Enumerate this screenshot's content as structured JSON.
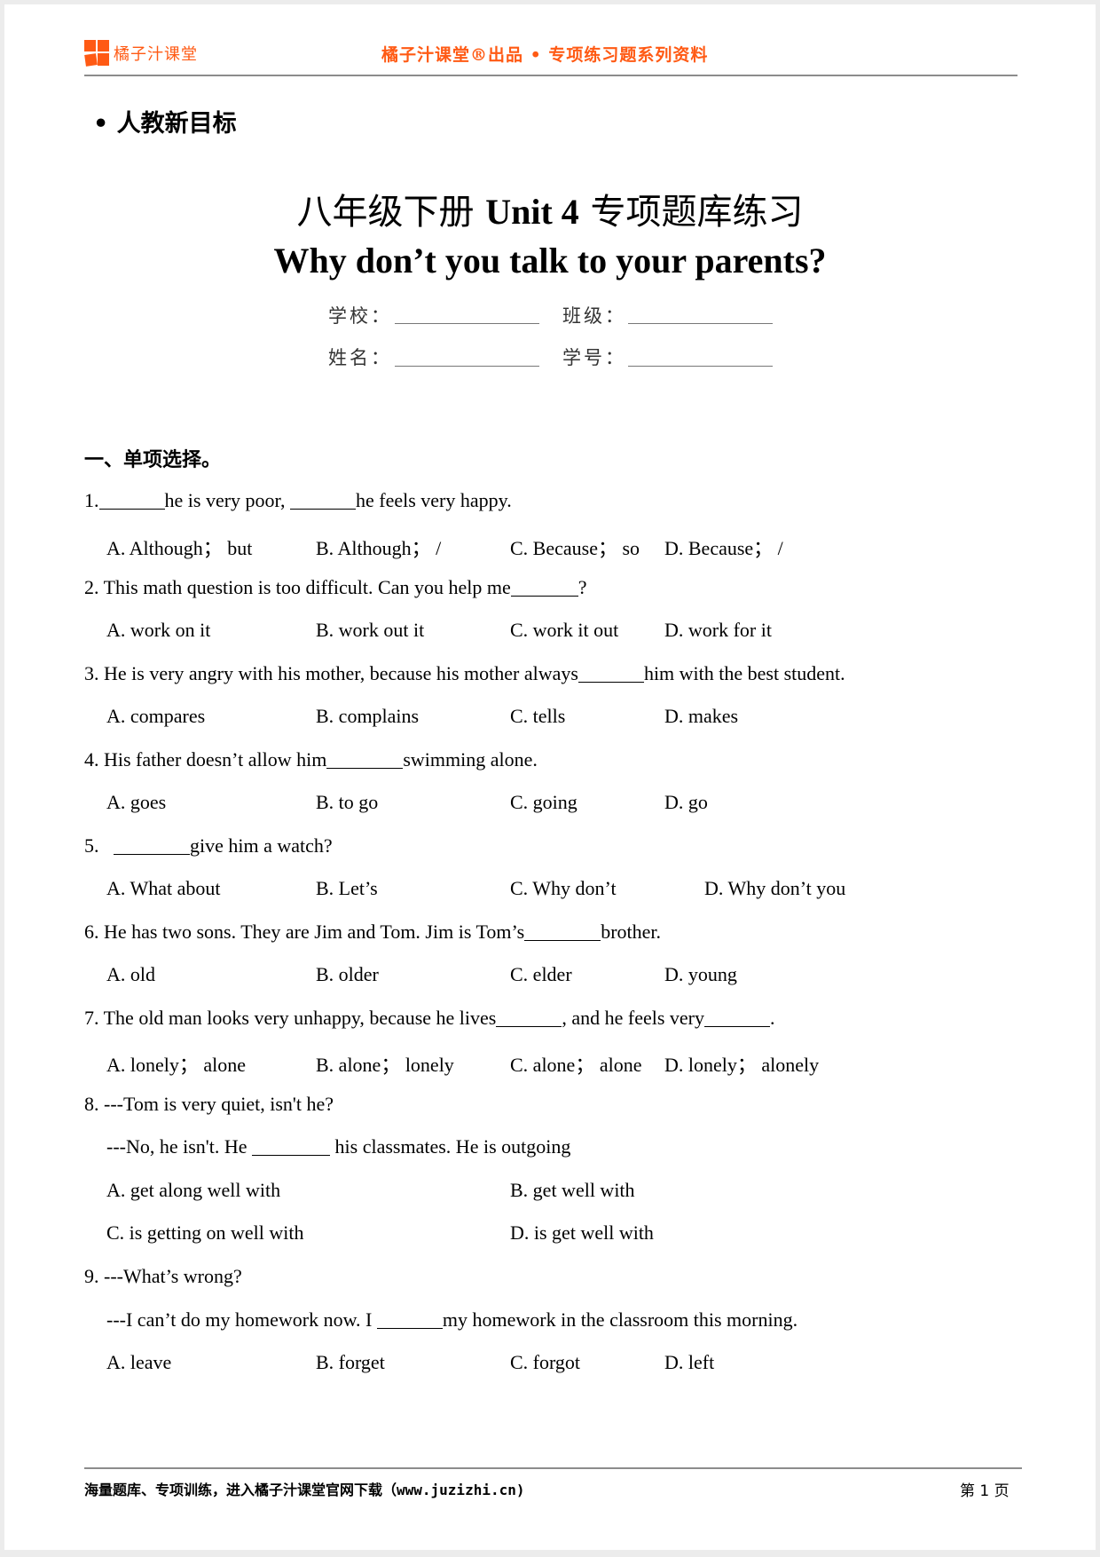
{
  "header": {
    "brand": "橘子汁课堂",
    "center": "橘子汁课堂®出品 • 专项练习题系列资料",
    "logo_color": "#ff5a14"
  },
  "series_label": "• 人教新目标",
  "title": {
    "cn_prefix": "八年级下册 ",
    "unit": "Unit 4",
    "cn_suffix": " 专项题库练习",
    "subtitle": "Why don’t you talk to your parents?"
  },
  "form": {
    "school": "学校：",
    "class": "班级：",
    "name": "姓名：",
    "student_no": "学号："
  },
  "section": {
    "heading": "一、单项选择。"
  },
  "questions": [
    {
      "num": "1.",
      "parts": [
        "",
        "he is very poor,  ",
        "he feels very happy."
      ],
      "options": [
        "A. Although；  but",
        "B. Although；  /",
        "C. Because；  so",
        "D. Because；  /"
      ]
    },
    {
      "num": "2.",
      "parts": [
        "This math question is too difficult. Can you help me",
        "?"
      ],
      "options": [
        "A. work on it",
        "B. work out it",
        "C. work it out",
        "D. work for it"
      ]
    },
    {
      "num": "3.",
      "parts": [
        "He is very angry with his mother, because his mother always",
        "him with the best student."
      ],
      "options": [
        "A. compares",
        "B. complains",
        "C. tells",
        "D. makes"
      ]
    },
    {
      "num": "4.",
      "parts": [
        "His father doesn’t allow him",
        "swimming alone."
      ],
      "options": [
        "A. goes",
        "B. to go",
        "C. going",
        "D. go"
      ]
    },
    {
      "num": "5.",
      "parts": [
        "",
        "give him a watch?"
      ],
      "options": [
        "A. What about",
        "B. Let’s",
        "C. Why don’t",
        "D. Why don’t you"
      ]
    },
    {
      "num": "6.",
      "parts": [
        "He has two sons. They are Jim and Tom. Jim is Tom’s",
        "brother."
      ],
      "options": [
        "A. old",
        "B. older",
        "C. elder",
        "D. young"
      ]
    },
    {
      "num": "7.",
      "parts": [
        "The old man looks very unhappy, because he lives",
        ", and he feels very",
        "."
      ],
      "options": [
        "A. lonely；  alone",
        "B. alone；  lonely",
        "C. alone；  alone",
        "D. lonely；  alonely"
      ]
    },
    {
      "num": "8.",
      "line1": "---Tom is very quiet, isn't he?",
      "parts": [
        "---No, he isn't. He ",
        " his classmates. He is outgoing"
      ],
      "options": [
        "A. get along well with",
        "B. get well with",
        "C. is getting on well with",
        "D. is get well with"
      ]
    },
    {
      "num": "9.",
      "line1": "---What’s wrong?",
      "parts": [
        "---I can’t do my homework now. I  ",
        "my homework in the classroom this morning."
      ],
      "options": [
        "A. leave",
        "B. forget",
        "C. forgot",
        "D. left"
      ]
    }
  ],
  "footer": {
    "left": "海量题库、专项训练，进入橘子汁课堂官网下载（www.juzizhi.cn)",
    "page_label": "第 1 页"
  }
}
